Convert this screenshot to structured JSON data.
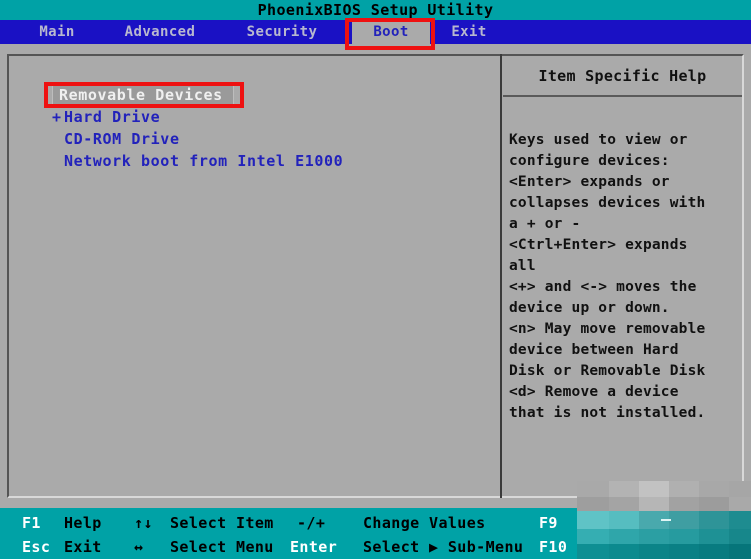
{
  "window": {
    "title": "PhoenixBIOS Setup Utility"
  },
  "colors": {
    "title_bar_bg": "#00a2a6",
    "menu_bar_bg": "#1a11c4",
    "panel_bg": "#aaaaaa",
    "list_text": "#2222bb",
    "selection_bg": "#9a9a9a",
    "selection_text": "#f0f0f0",
    "status_bar_bg": "#00a2a6",
    "annotation": "#ee1111"
  },
  "menu": {
    "tabs": [
      {
        "label": "Main",
        "active": false
      },
      {
        "label": "Advanced",
        "active": false
      },
      {
        "label": "Security",
        "active": false
      },
      {
        "label": "Boot",
        "active": true
      },
      {
        "label": "Exit",
        "active": false
      }
    ]
  },
  "boot_order": {
    "items": [
      {
        "prefix": "",
        "label": "Removable Devices",
        "selected": true
      },
      {
        "prefix": "+",
        "label": "Hard Drive",
        "selected": false
      },
      {
        "prefix": "",
        "label": "CD-ROM Drive",
        "selected": false
      },
      {
        "prefix": "",
        "label": "Network boot from Intel E1000",
        "selected": false
      }
    ]
  },
  "help": {
    "header": "Item Specific Help",
    "lines": [
      "Keys used to view or",
      "configure devices:",
      "<Enter> expands or",
      "collapses devices with",
      "a + or -",
      "<Ctrl+Enter> expands",
      "all",
      "<+> and <-> moves the",
      "device up or down.",
      "<n> May move removable",
      "device between Hard",
      "Disk or Removable Disk",
      "<d> Remove a device",
      "that is not installed."
    ]
  },
  "status_bar": {
    "rows": [
      [
        {
          "key": "F1",
          "desc": "Help"
        },
        {
          "key": "↑↓",
          "desc": "Select Item"
        },
        {
          "key": "-/+",
          "desc": "Change Values"
        },
        {
          "key": "F9",
          "desc": ""
        }
      ],
      [
        {
          "key": "Esc",
          "desc": "Exit"
        },
        {
          "key": "↔",
          "desc": "Select Menu"
        },
        {
          "key": "Enter",
          "desc": "Select ▶ Sub-Menu"
        },
        {
          "key": "F10",
          "desc": ""
        }
      ]
    ]
  },
  "annotations": [
    {
      "name": "boot-tab-highlight",
      "target": "Boot"
    },
    {
      "name": "removable-devices-highlight",
      "target": "Removable Devices"
    }
  ]
}
